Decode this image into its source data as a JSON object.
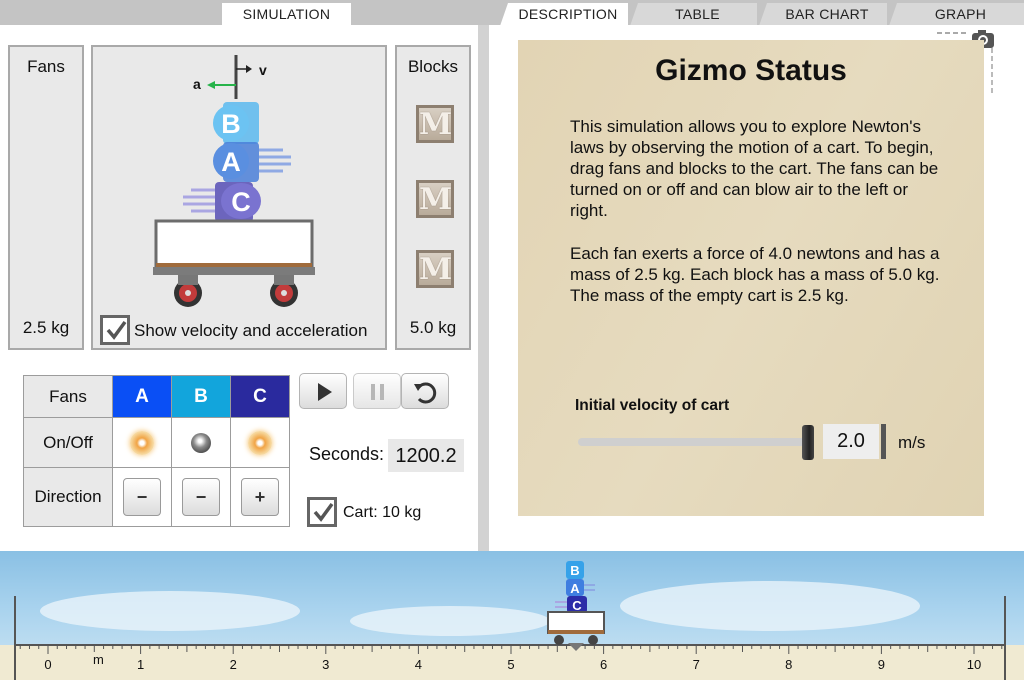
{
  "tabs": {
    "simulation": "SIMULATION",
    "description": "DESCRIPTION",
    "table": "TABLE",
    "bar_chart": "BAR CHART",
    "graph": "GRAPH"
  },
  "fans_panel": {
    "title": "Fans",
    "mass": "2.5 kg"
  },
  "blocks_panel": {
    "title": "Blocks",
    "mass": "5.0 kg",
    "block_letter": "M"
  },
  "cart_view": {
    "acceleration_label": "a",
    "velocity_label": "v",
    "fans": [
      "B",
      "A",
      "C"
    ],
    "show_vectors_label": "Show velocity and acceleration",
    "show_vectors_checked": true
  },
  "fan_table": {
    "fans_header": "Fans",
    "onoff_label": "On/Off",
    "direction_label": "Direction",
    "columns": [
      {
        "name": "A",
        "color": "#0a4ff5",
        "on": true,
        "direction": "−"
      },
      {
        "name": "B",
        "color": "#12a5dc",
        "on": false,
        "direction": "−"
      },
      {
        "name": "C",
        "color": "#2a2a9e",
        "on": true,
        "direction": "+"
      }
    ]
  },
  "controls": {
    "play_icon": "play-icon",
    "pause_icon": "pause-icon",
    "reset_icon": "reset-icon",
    "seconds_label": "Seconds:",
    "seconds_value": "1200.2",
    "cart_label": "Cart: 10 kg",
    "cart_checked": true
  },
  "status": {
    "title": "Gizmo Status",
    "paragraph1": "This simulation allows you to explore Newton's laws by observing the motion of a cart. To begin, drag fans and blocks to the cart. The fans can be turned on or off and can blow air to the left or right.",
    "paragraph2": "Each fan exerts a force of 4.0 newtons and has a mass of 2.5 kg. Each block has a mass of 5.0 kg. The mass of the empty cart is 2.5 kg.",
    "velocity_label": "Initial velocity of cart",
    "velocity_value": "2.0",
    "velocity_unit": "m/s",
    "velocity_slider_fraction": 1.0
  },
  "track": {
    "unit": "m",
    "numbers": [
      "0",
      "1",
      "2",
      "3",
      "4",
      "5",
      "6",
      "7",
      "8",
      "9",
      "10"
    ],
    "cart_position_m": 5.7
  },
  "colors": {
    "fan_a": "#2a93e8",
    "fan_b": "#5bb8ee",
    "fan_c": "#6a62c9",
    "arrow": "#27b34a"
  }
}
